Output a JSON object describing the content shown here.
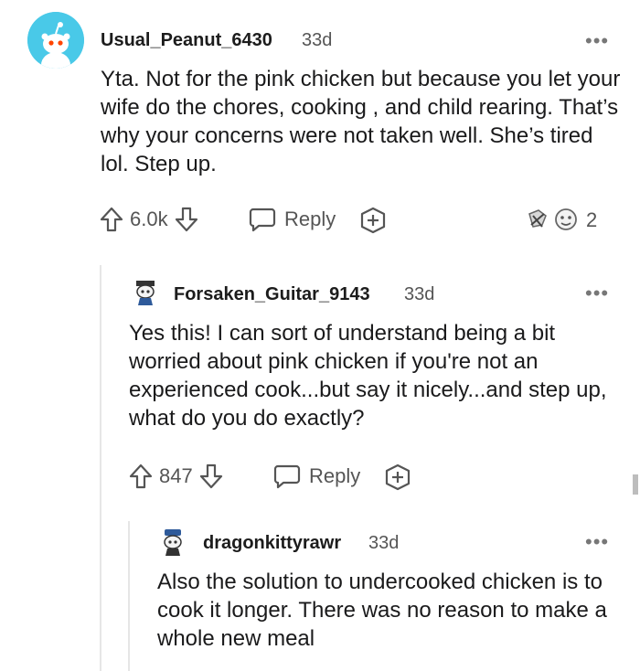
{
  "comments": [
    {
      "username": "Usual_Peanut_6430",
      "age": "33d",
      "more": "•••",
      "body": "Yta. Not for the pink chicken but because you let your wife do the chores, cooking , and child rearing. That’s why your concerns were not taken well. She’s tired lol. Step up.",
      "score": "6.0k",
      "reply_label": "Reply",
      "award_count": "2"
    },
    {
      "username": "Forsaken_Guitar_9143",
      "age": "33d",
      "more": "•••",
      "body": "Yes this! I can sort of understand being a bit worried about pink chicken if you're not an experienced cook...but say it nicely...and step up, what do you do exactly?",
      "score": "847",
      "reply_label": "Reply"
    },
    {
      "username": "dragonkittyrawr",
      "age": "33d",
      "more": "•••",
      "body": "Also the solution to undercooked chicken is to cook it longer. There was no reason to make a whole new meal"
    }
  ],
  "colors": {
    "avatar_bg": "#49c9e8",
    "text": "#1a1a1b",
    "meta": "#555555"
  },
  "icons": [
    "snoo-avatar-icon",
    "upvote-icon",
    "downvote-icon",
    "reply-icon",
    "award-icon",
    "more-options-icon"
  ]
}
